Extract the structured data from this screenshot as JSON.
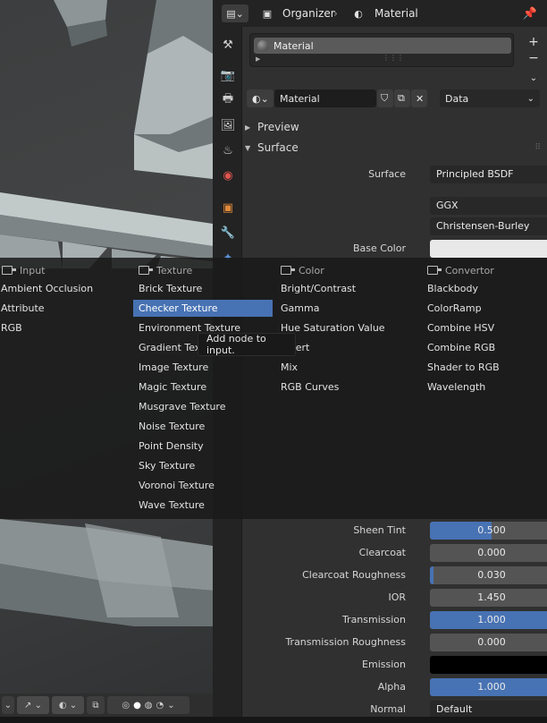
{
  "header": {
    "organizer_label": "Organizer",
    "material_label": "Material"
  },
  "slots": {
    "items": [
      "Material"
    ]
  },
  "material_row": {
    "name": "Material",
    "link": "Data"
  },
  "panels": {
    "preview": "Preview",
    "surface": "Surface"
  },
  "surface": {
    "surface_label": "Surface",
    "surface_value": "Principled BSDF",
    "distribution": "GGX",
    "subsurface_method": "Christensen-Burley",
    "base_color_label": "Base Color",
    "base_color": "#e8e8e8"
  },
  "properties": [
    {
      "label": "Sheen Tint",
      "value": "0.500",
      "fraction": 0.5
    },
    {
      "label": "Clearcoat",
      "value": "0.000",
      "fraction": 0.0
    },
    {
      "label": "Clearcoat Roughness",
      "value": "0.030",
      "fraction": 0.03
    },
    {
      "label": "IOR",
      "value": "1.450",
      "fraction": 0.0
    },
    {
      "label": "Transmission",
      "value": "1.000",
      "fraction": 1.0
    },
    {
      "label": "Transmission Roughness",
      "value": "0.000",
      "fraction": 0.0
    },
    {
      "label": "Emission",
      "value": "",
      "color": "#000000"
    },
    {
      "label": "Alpha",
      "value": "1.000",
      "fraction": 1.0
    },
    {
      "label": "Normal",
      "value": "Default"
    }
  ],
  "menu": {
    "columns": [
      {
        "title": "Input",
        "items": [
          "Ambient Occlusion",
          "Attribute",
          "RGB"
        ]
      },
      {
        "title": "Texture",
        "items": [
          "Brick Texture",
          "Checker Texture",
          "Environment Texture",
          "Gradient Tex",
          "Image Texture",
          "Magic Texture",
          "Musgrave Texture",
          "Noise Texture",
          "Point Density",
          "Sky Texture",
          "Voronoi Texture",
          "Wave Texture"
        ]
      },
      {
        "title": "Color",
        "items": [
          "Bright/Contrast",
          "Gamma",
          "Hue Saturation Value",
          "Invert",
          "Mix",
          "RGB Curves"
        ]
      },
      {
        "title": "Convertor",
        "items": [
          "Blackbody",
          "ColorRamp",
          "Combine HSV",
          "Combine RGB",
          "Shader to RGB",
          "Wavelength"
        ]
      }
    ],
    "selected": "Checker Texture",
    "tooltip": "Add node to input."
  },
  "colors": {
    "accent": "#4772b3",
    "panel_bg": "#303030",
    "header_bg": "#232323"
  }
}
